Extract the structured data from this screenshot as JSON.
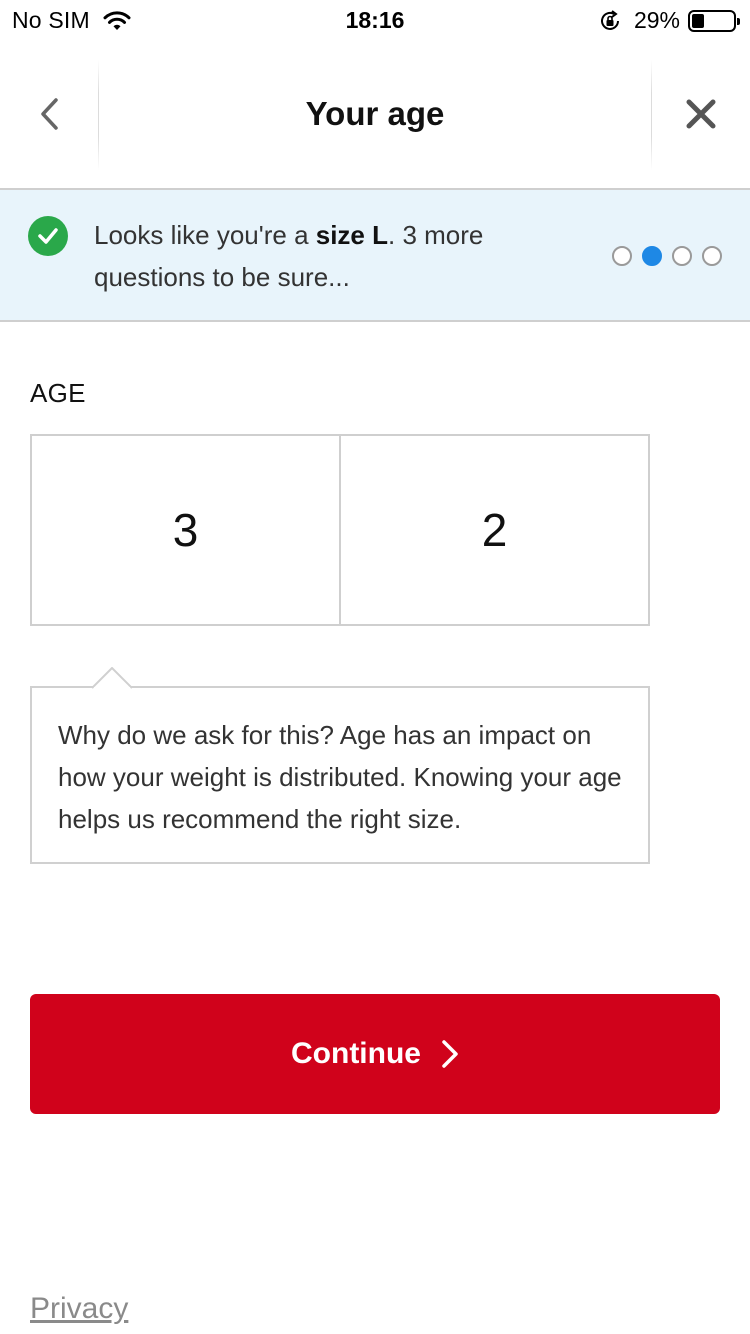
{
  "status_bar": {
    "carrier": "No SIM",
    "time": "18:16",
    "battery_percent": "29%",
    "battery_level": 0.29
  },
  "header": {
    "title": "Your age",
    "back_icon": "chevron-left-icon",
    "close_icon": "close-icon"
  },
  "banner": {
    "text_before": "Looks like you're a ",
    "size_text": "size L",
    "text_after": ". 3 more questions to be sure...",
    "progress": {
      "total": 4,
      "active_index": 1
    },
    "colors": {
      "background": "#e8f4fb",
      "check": "#2aa84a",
      "active_dot": "#1e88e5"
    }
  },
  "age": {
    "label": "AGE",
    "digits": [
      "3",
      "2"
    ]
  },
  "info": {
    "text": "Why do we ask for this? Age has an impact on how your weight is distributed. Knowing your age helps us recommend the right size."
  },
  "actions": {
    "continue_label": "Continue",
    "continue_color": "#d0021b"
  },
  "footer": {
    "privacy_label": "Privacy"
  }
}
